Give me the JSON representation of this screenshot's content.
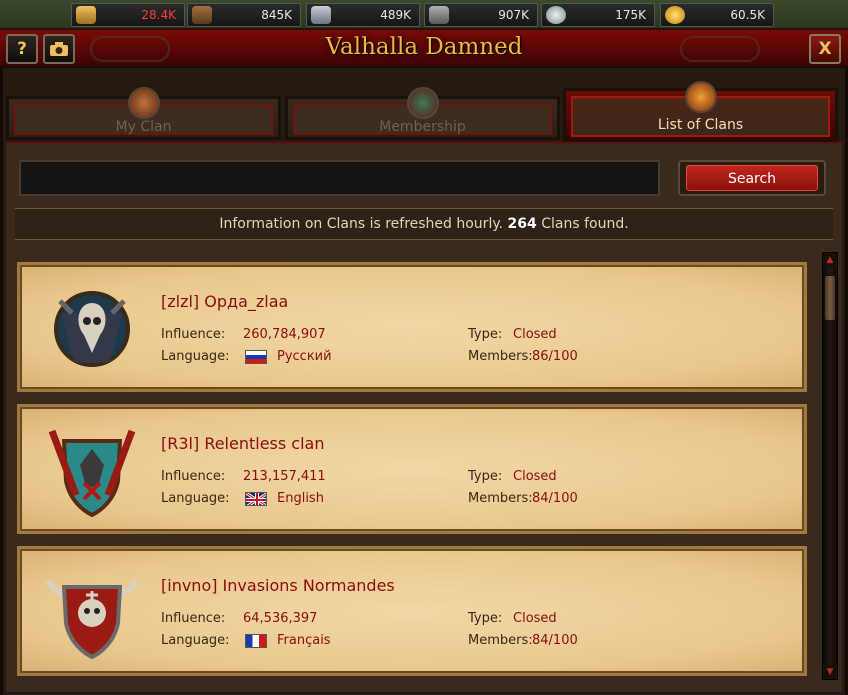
{
  "resources": [
    {
      "icon": "grain-icon",
      "value": "28.4K",
      "low": true
    },
    {
      "icon": "wood-icon",
      "value": "845K",
      "low": false
    },
    {
      "icon": "iron-icon",
      "value": "489K",
      "low": false
    },
    {
      "icon": "stone-icon",
      "value": "907K",
      "low": false
    },
    {
      "icon": "silver-icon",
      "value": "175K",
      "low": false
    },
    {
      "icon": "gold-icon",
      "value": "60.5K",
      "low": false
    }
  ],
  "window": {
    "title": "Valhalla Damned",
    "help_label": "?",
    "close_label": "X"
  },
  "tabs": [
    {
      "label": "My Clan",
      "active": false
    },
    {
      "label": "Membership",
      "active": false
    },
    {
      "label": "List of Clans",
      "active": true
    }
  ],
  "search": {
    "value": "",
    "button_label": "Search"
  },
  "info": {
    "prefix": "Information on Clans is refreshed hourly.",
    "count": "264",
    "suffix": "Clans found."
  },
  "labels": {
    "influence": "Influence:",
    "language": "Language:",
    "type": "Type:",
    "members": "Members:"
  },
  "clans": [
    {
      "name": "[zlzl] Орда_zlaa",
      "influence": "260,784,907",
      "language": "Русский",
      "flag": "ru",
      "type": "Closed",
      "members": "86/100"
    },
    {
      "name": "[R3l] Relentless clan",
      "influence": "213,157,411",
      "language": "English",
      "flag": "gb",
      "type": "Closed",
      "members": "84/100"
    },
    {
      "name": "[invno] Invasions Normandes",
      "influence": "64,536,397",
      "language": "Français",
      "flag": "fr",
      "type": "Closed",
      "members": "84/100"
    }
  ],
  "colors": {
    "accent": "#8a0c0c",
    "title": "#f2b540",
    "button": "#c2261c"
  }
}
